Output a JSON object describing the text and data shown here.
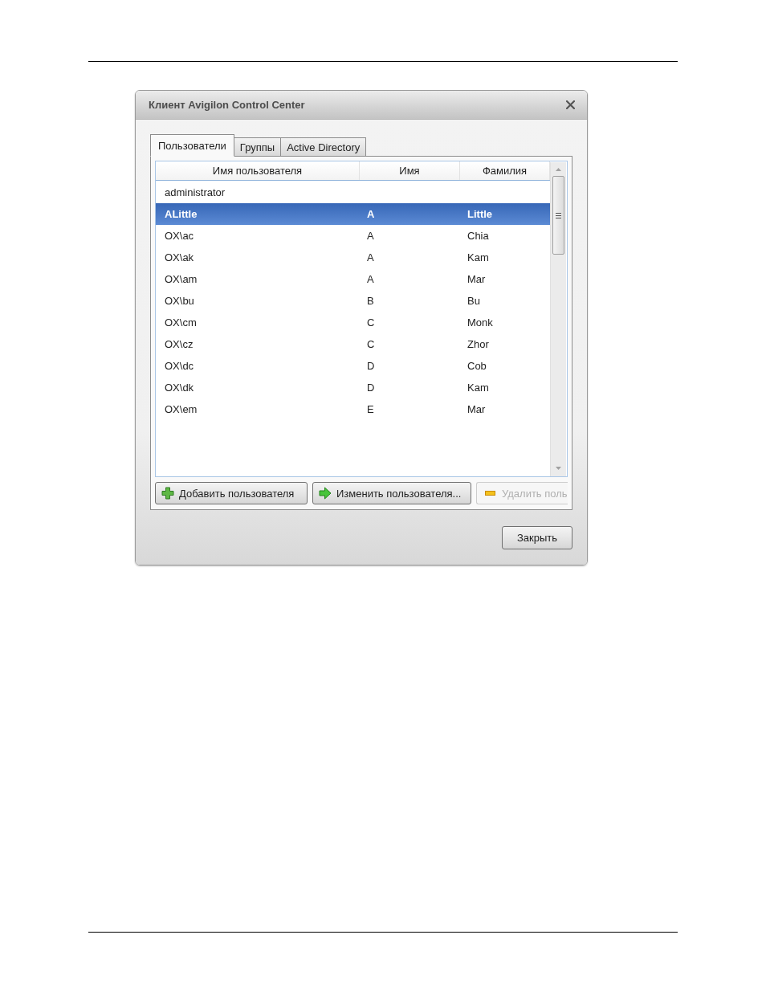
{
  "window": {
    "title": "Клиент Avigilon Control Center"
  },
  "tabs": [
    {
      "label": "Пользователи",
      "selected": true
    },
    {
      "label": "Группы",
      "selected": false
    },
    {
      "label": "Active Directory",
      "selected": false
    }
  ],
  "table": {
    "columns": [
      "Имя пользователя",
      "Имя",
      "Фамилия"
    ],
    "rows": [
      {
        "username": "administrator",
        "selected": false
      },
      {
        "username": "ALittle",
        "first_name": "A",
        "last_name": "Little",
        "selected": true
      },
      {
        "username": "OX\\ac",
        "first_name": "A",
        "last_name": "Chia",
        "selected": false
      },
      {
        "username": "OX\\ak",
        "first_name": "A",
        "last_name": "Kam",
        "selected": false
      },
      {
        "username": "OX\\am",
        "first_name": "A",
        "last_name": "Mar",
        "selected": false
      },
      {
        "username": "OX\\bu",
        "first_name": "B",
        "last_name": "Bu",
        "selected": false
      },
      {
        "username": "OX\\cm",
        "first_name": "C",
        "last_name": "Monk",
        "selected": false
      },
      {
        "username": "OX\\cz",
        "first_name": "C",
        "last_name": "Zhor",
        "selected": false
      },
      {
        "username": "OX\\dc",
        "first_name": "D",
        "last_name": "Cob",
        "selected": false
      },
      {
        "username": "OX\\dk",
        "first_name": "D",
        "last_name": "Kam",
        "selected": false
      },
      {
        "username": "OX\\em",
        "first_name": "E",
        "last_name": "Mar",
        "selected": false
      }
    ]
  },
  "buttons": [
    {
      "kind": "add",
      "label": "Добавить пользователя",
      "disabled": false
    },
    {
      "kind": "edit",
      "label": "Изменить пользователя...",
      "disabled": false
    },
    {
      "kind": "remove",
      "label": "Удалить поль",
      "disabled": true
    }
  ],
  "footer_button": {
    "label": "Закрыть"
  }
}
